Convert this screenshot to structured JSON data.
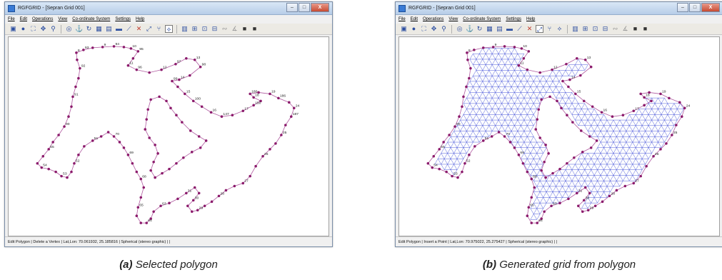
{
  "window_a": {
    "title": "RGFGRID - [Sepran Grid 001]",
    "status": "Edit Polygon | Delete a Vertex | Lat,Lon:    70.061932,     25.185816 |  Spherical (stereo graphic) |  |"
  },
  "window_b": {
    "title": "RGFGRID - [Sepran Grid 001]",
    "status": "Edit Polygon | Insert a Point | Lat,Lon:    70.975022,     25.275427 |  Spherical (stereo graphic) |  |"
  },
  "window_buttons": {
    "minimize": "–",
    "maximize": "□",
    "close": "X"
  },
  "menu": [
    "File",
    "Edit",
    "Operations",
    "View",
    "Co-ordinate System",
    "Settings",
    "Help"
  ],
  "toolbar_icons": [
    "print-icon",
    "globe-icon",
    "zoom-extent-icon",
    "pan-icon",
    "zoom-icon",
    "circle-icon",
    "anchor-icon",
    "refresh-icon",
    "grid-icon",
    "layer-icon",
    "fill-icon",
    "spline-icon",
    "delete-icon",
    "move-icon",
    "split-icon",
    "polygon-icon",
    "table-icon",
    "export-icon",
    "frame-icon",
    "box-icon",
    "curve-icon",
    "measure-icon",
    "square-icon",
    "square2-icon"
  ],
  "vertex_labels_top": [
    "8",
    "9",
    "10",
    "11",
    "12",
    "13",
    "14",
    "15",
    "16",
    "17",
    "18",
    "19"
  ],
  "vertex_labels_misc": [
    "24",
    "25",
    "26",
    "27",
    "28",
    "29",
    "30",
    "31",
    "63",
    "64",
    "65",
    "68",
    "69",
    "70",
    "51",
    "52",
    "53",
    "54",
    "55",
    "90",
    "91",
    "92",
    "93",
    "94",
    "95",
    "96",
    "97",
    "98",
    "99",
    "100",
    "147",
    "150",
    "180",
    "186",
    "187"
  ],
  "captions": {
    "a_label": "(a)",
    "a_text": "Selected polygon",
    "b_label": "(b)",
    "b_text": "Generated grid from polygon"
  },
  "colors": {
    "vertex": "#8b1a6b",
    "outline": "#b05aa0",
    "mesh": "#2030d0"
  }
}
